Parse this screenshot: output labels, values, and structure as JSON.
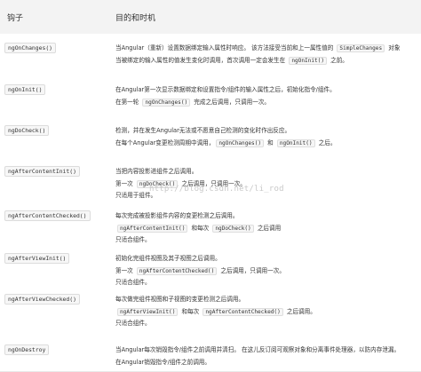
{
  "header": {
    "hook_col": "钩子",
    "timing_col": "目的和时机"
  },
  "rows": [
    {
      "hook": "ngOnChanges()",
      "lines": [
        [
          {
            "t": "当Angular（重新）设置数据绑定输入属性时响应。 该方法接受当前和上一属性值的 "
          },
          {
            "c": "SimpleChanges"
          },
          {
            "t": " 对象"
          }
        ],
        [
          {
            "t": "当被绑定的输入属性的值发生变化时调用，首次调用一定会发生在 "
          },
          {
            "c": "ngOnInit()"
          },
          {
            "t": " 之前。"
          }
        ]
      ]
    },
    {
      "hook": "ngOnInit()",
      "lines": [
        [
          {
            "t": "在Angular第一次显示数据绑定和设置指令/组件的输入属性之后，初始化指令/组件。"
          }
        ],
        [
          {
            "t": "在第一轮 "
          },
          {
            "c": "ngOnChanges()"
          },
          {
            "t": " 完成之后调用，只调用一次。"
          }
        ]
      ]
    },
    {
      "hook": "ngDoCheck()",
      "lines": [
        [
          {
            "t": "检测，并在发生Angular无法或不愿意自己检测的变化时作出反应。"
          }
        ],
        [
          {
            "t": "在每个Angular变更检测周期中调用，"
          },
          {
            "c": "ngOnChanges()"
          },
          {
            "t": " 和 "
          },
          {
            "c": "ngOnInit()"
          },
          {
            "t": " 之后。"
          }
        ]
      ]
    },
    {
      "hook": "ngAfterContentInit()",
      "lines": [
        [
          {
            "t": "当把内容投影进组件之后调用。"
          }
        ],
        [
          {
            "t": "第一次 "
          },
          {
            "c": "ngDoCheck()"
          },
          {
            "t": " 之后调用，只调用一次。"
          }
        ],
        [
          {
            "t": "只适用于组件。"
          }
        ]
      ]
    },
    {
      "hook": "ngAfterContentChecked()",
      "lines": [
        [
          {
            "t": "每次完成被投影组件内容的变更检测之后调用。"
          }
        ],
        [
          {
            "c": "ngAfterContentInit()"
          },
          {
            "t": " 和每次 "
          },
          {
            "c": "ngDoCheck()"
          },
          {
            "t": " 之后调用"
          }
        ],
        [
          {
            "t": "只适合组件。"
          }
        ]
      ]
    },
    {
      "hook": "ngAfterViewInit()",
      "lines": [
        [
          {
            "t": "初始化完组件视图及其子视图之后调用。"
          }
        ],
        [
          {
            "t": "第一次 "
          },
          {
            "c": "ngAfterContentChecked()"
          },
          {
            "t": " 之后调用，只调用一次。"
          }
        ],
        [
          {
            "t": "只适合组件。"
          }
        ]
      ]
    },
    {
      "hook": "ngAfterViewChecked()",
      "lines": [
        [
          {
            "t": "每次做完组件视图和子视图的变更检测之后调用。"
          }
        ],
        [
          {
            "c": "ngAfterViewInit()"
          },
          {
            "t": " 和每次 "
          },
          {
            "c": "ngAfterContentChecked()"
          },
          {
            "t": " 之后调用。"
          }
        ],
        [
          {
            "t": "只适合组件。"
          }
        ]
      ]
    },
    {
      "hook": "ngOnDestroy",
      "lines": [
        [
          {
            "t": "当Angular每次销毁指令/组件之前调用并清扫。 在这儿反订阅可观察对象和分离事件处理器，以防内存泄漏。"
          }
        ],
        [
          {
            "t": "在Angular销毁指令/组件之前调用。"
          }
        ]
      ]
    }
  ],
  "watermark": "http://blog.csdn.net/li_rod"
}
